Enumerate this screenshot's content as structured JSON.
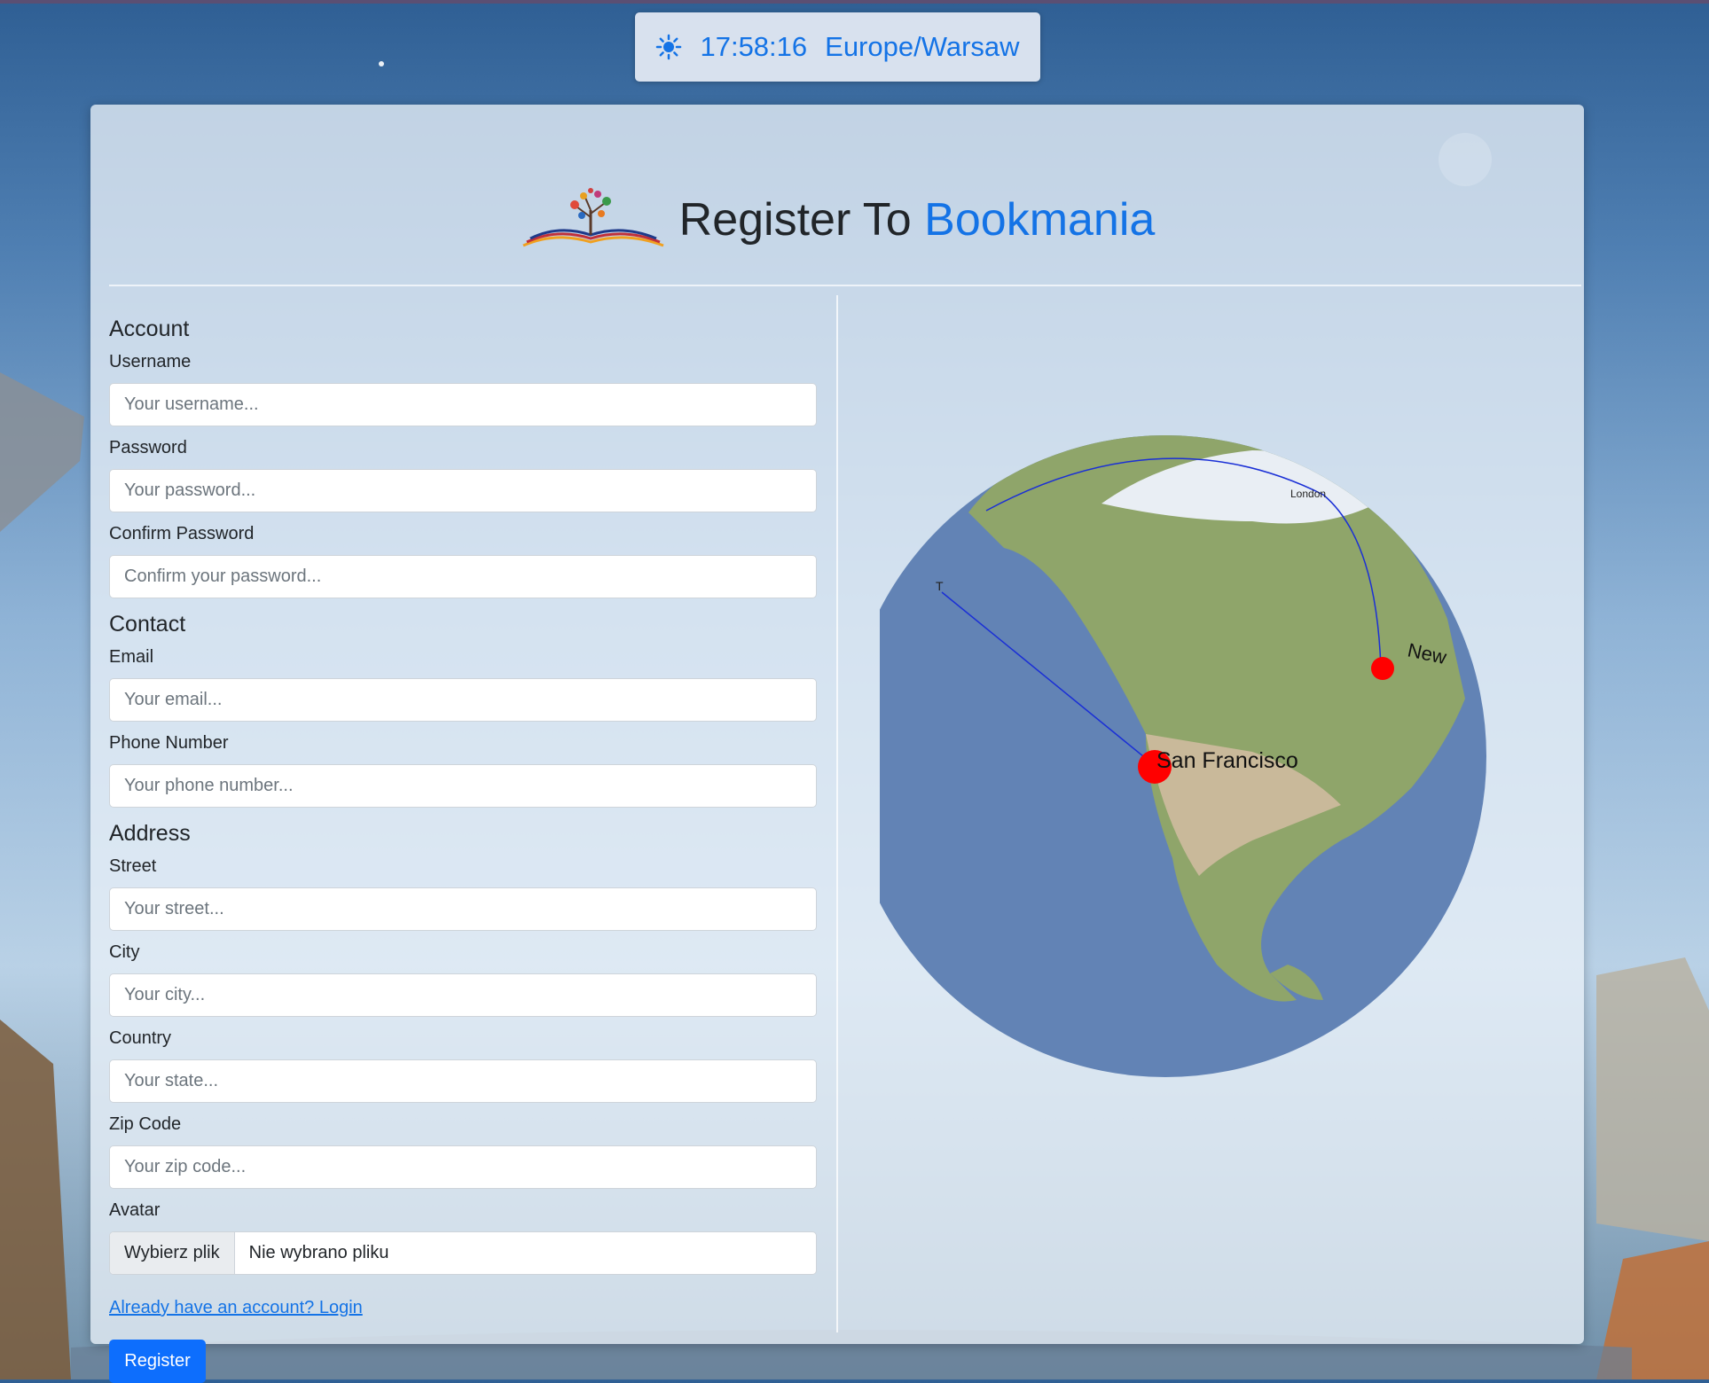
{
  "clock": {
    "icon": "sun-icon",
    "time": "17:58:16",
    "timezone": "Europe/Warsaw"
  },
  "header": {
    "title_prefix": "Register To ",
    "title_brand": "Bookmania",
    "logo_icon": "book-tree-logo"
  },
  "form": {
    "account": {
      "heading": "Account",
      "username": {
        "label": "Username",
        "placeholder": "Your username..."
      },
      "password": {
        "label": "Password",
        "placeholder": "Your password..."
      },
      "confirm": {
        "label": "Confirm Password",
        "placeholder": "Confirm your password..."
      }
    },
    "contact": {
      "heading": "Contact",
      "email": {
        "label": "Email",
        "placeholder": "Your email..."
      },
      "phone": {
        "label": "Phone Number",
        "placeholder": "Your phone number..."
      }
    },
    "address": {
      "heading": "Address",
      "street": {
        "label": "Street",
        "placeholder": "Your street..."
      },
      "city": {
        "label": "City",
        "placeholder": "Your city..."
      },
      "country": {
        "label": "Country",
        "placeholder": "Your state..."
      },
      "zip": {
        "label": "Zip Code",
        "placeholder": "Your zip code..."
      }
    },
    "avatar": {
      "label": "Avatar",
      "button": "Wybierz plik",
      "filename": "Nie wybrano pliku"
    },
    "login_link": "Already have an account? Login",
    "register_button": "Register"
  },
  "globe": {
    "labels": [
      "San Francisco",
      "New",
      "London",
      "T"
    ],
    "colors": {
      "ocean": "#6283b5",
      "route": "#1a2fd6",
      "marker": "#ff0000"
    }
  },
  "colors": {
    "accent": "#1473e6",
    "button": "#0d6efd"
  }
}
